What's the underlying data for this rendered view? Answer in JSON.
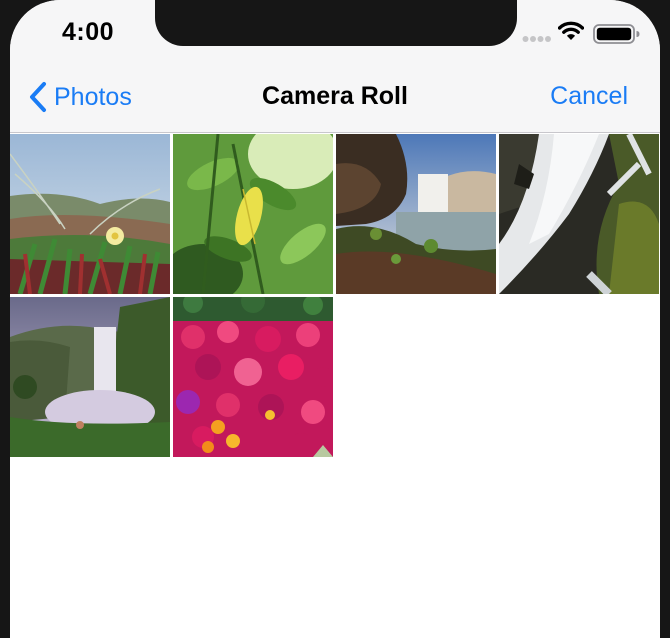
{
  "status_bar": {
    "time": "4:00",
    "icons": [
      "signal-dots-icon",
      "wifi-icon",
      "battery-icon"
    ]
  },
  "nav": {
    "back_label": "Photos",
    "title": "Camera Roll",
    "cancel_label": "Cancel"
  },
  "colors": {
    "accent": "#1a7cf5",
    "bar_background": "#f6f6f7",
    "frame": "#161616"
  },
  "photos": [
    {
      "subject": "grass-flower"
    },
    {
      "subject": "yellow-leaf"
    },
    {
      "subject": "waterfall-cliffs"
    },
    {
      "subject": "waterfall-rocks"
    },
    {
      "subject": "waterfall-valley"
    },
    {
      "subject": "pink-flowers"
    }
  ]
}
